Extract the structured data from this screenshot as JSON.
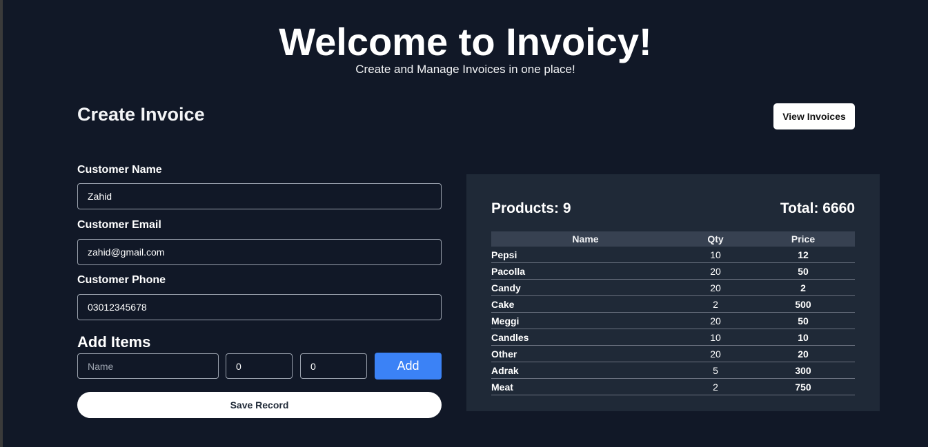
{
  "header": {
    "title": "Welcome to Invoicy!",
    "subtitle": "Create and Manage Invoices in one place!"
  },
  "create": {
    "title": "Create Invoice",
    "view_invoices_label": "View Invoices"
  },
  "form": {
    "name_label": "Customer Name",
    "name_value": "Zahid",
    "email_label": "Customer Email",
    "email_value": "zahid@gmail.com",
    "phone_label": "Customer Phone",
    "phone_value": "03012345678"
  },
  "add_items": {
    "title": "Add Items",
    "name_placeholder": "Name",
    "qty_value": "0",
    "price_value": "0",
    "add_label": "Add",
    "save_label": "Save Record"
  },
  "summary": {
    "products_text": "Products: 9",
    "total_text": "Total: 6660",
    "columns": [
      "Name",
      "Qty",
      "Price"
    ],
    "rows": [
      {
        "name": "Pepsi",
        "qty": "10",
        "price": "12"
      },
      {
        "name": "Pacolla",
        "qty": "20",
        "price": "50"
      },
      {
        "name": "Candy",
        "qty": "20",
        "price": "2"
      },
      {
        "name": "Cake",
        "qty": "2",
        "price": "500"
      },
      {
        "name": "Meggi",
        "qty": "20",
        "price": "50"
      },
      {
        "name": "Candles",
        "qty": "10",
        "price": "10"
      },
      {
        "name": "Other",
        "qty": "20",
        "price": "20"
      },
      {
        "name": "Adrak",
        "qty": "5",
        "price": "300"
      },
      {
        "name": "Meat",
        "qty": "2",
        "price": "750"
      }
    ]
  }
}
